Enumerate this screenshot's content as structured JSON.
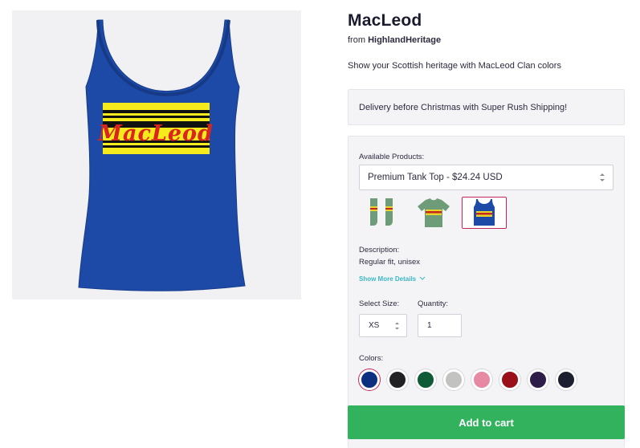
{
  "product": {
    "title": "MacLeod",
    "from_prefix": "from",
    "store": "HighlandHeritage",
    "tagline": "Show your Scottish heritage with MacLeod Clan colors",
    "artwork_text": "MacLeod"
  },
  "delivery": {
    "text": "Delivery before Christmas with Super Rush Shipping!"
  },
  "products": {
    "label": "Available Products:",
    "selected": "Premium Tank Top - $24.24 USD",
    "thumbnails": [
      {
        "name": "socks",
        "selected": false
      },
      {
        "name": "t-shirt",
        "selected": false
      },
      {
        "name": "tank-top",
        "selected": true
      }
    ]
  },
  "description": {
    "label": "Description:",
    "text": "Regular fit, unisex",
    "more_link": "Show More Details"
  },
  "size": {
    "label": "Select Size:",
    "value": "XS"
  },
  "quantity": {
    "label": "Quantity:",
    "value": "1"
  },
  "colors": {
    "label": "Colors:",
    "swatches": [
      "#0d2f80",
      "#222225",
      "#0f5b38",
      "#c2c2c0",
      "#e889a3",
      "#9a0f18",
      "#2c1d49",
      "#1b1f30"
    ],
    "selected_index": 0
  },
  "cart": {
    "label": "Add to cart"
  },
  "theme": {
    "accent": "#33b25e",
    "link": "#3bb8c4",
    "selected_border": "#c0265a",
    "shirt_blue": "#1d4aa6"
  }
}
